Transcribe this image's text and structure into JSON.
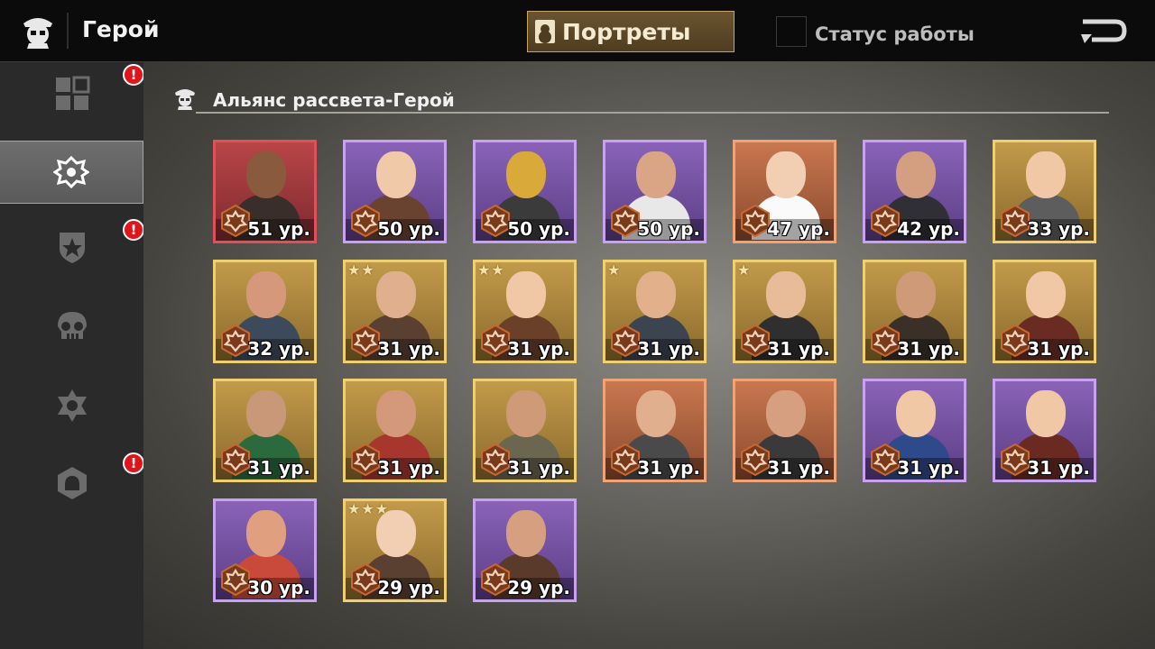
{
  "header": {
    "title": "Герой",
    "portraits_label": "Портреты",
    "status_label": "Статус работы",
    "status_checked": false
  },
  "sidebar": {
    "items": [
      {
        "name": "grid-icon",
        "badge": "!",
        "active": false
      },
      {
        "name": "alliance-emblem-icon",
        "badge": "",
        "active": true
      },
      {
        "name": "star-shield-icon",
        "badge": "!",
        "active": false
      },
      {
        "name": "skull-icon",
        "badge": "",
        "active": false
      },
      {
        "name": "hexagram-icon",
        "badge": "",
        "active": false
      },
      {
        "name": "helmet-hex-icon",
        "badge": "!",
        "active": false
      }
    ]
  },
  "section": {
    "title": "Альянс рассвета-Герой"
  },
  "heroes": [
    {
      "level": "51 ур.",
      "rarity": "red",
      "stars": "",
      "skin": "#8a5a3e",
      "outfit": "#3a2e2a"
    },
    {
      "level": "50 ур.",
      "rarity": "purple",
      "stars": "",
      "skin": "#f0c9a8",
      "outfit": "#6a4330"
    },
    {
      "level": "50 ур.",
      "rarity": "purple",
      "stars": "",
      "skin": "#d9a93a",
      "outfit": "#3b3b3b"
    },
    {
      "level": "50 ур.",
      "rarity": "purple",
      "stars": "",
      "skin": "#d9a585",
      "outfit": "#e8e8e8"
    },
    {
      "level": "47 ур.",
      "rarity": "orange",
      "stars": "",
      "skin": "#f2cfb2",
      "outfit": "#fafafa"
    },
    {
      "level": "42 ур.",
      "rarity": "purple",
      "stars": "",
      "skin": "#d49f80",
      "outfit": "#2f2f35"
    },
    {
      "level": "33 ур.",
      "rarity": "gold",
      "stars": "",
      "skin": "#f0c8a5",
      "outfit": "#5d5d5d"
    },
    {
      "level": "32 ур.",
      "rarity": "gold",
      "stars": "",
      "skin": "#d6987a",
      "outfit": "#3c4a5c"
    },
    {
      "level": "31 ур.",
      "rarity": "gold",
      "stars": "★★",
      "skin": "#e0b08e",
      "outfit": "#5a4030"
    },
    {
      "level": "31 ур.",
      "rarity": "gold",
      "stars": "★★",
      "skin": "#f0c8a5",
      "outfit": "#6a4028"
    },
    {
      "level": "31 ур.",
      "rarity": "gold",
      "stars": "★",
      "skin": "#e2b08a",
      "outfit": "#3c4450"
    },
    {
      "level": "31 ур.",
      "rarity": "gold",
      "stars": "★",
      "skin": "#e8bc98",
      "outfit": "#2f2f2f"
    },
    {
      "level": "31 ур.",
      "rarity": "gold",
      "stars": "",
      "skin": "#cf9a78",
      "outfit": "#3a3028"
    },
    {
      "level": "31 ур.",
      "rarity": "gold",
      "stars": "",
      "skin": "#f0c8a5",
      "outfit": "#6a2c22"
    },
    {
      "level": "31 ур.",
      "rarity": "gold",
      "stars": "",
      "skin": "#c89878",
      "outfit": "#2a6a3c"
    },
    {
      "level": "31 ур.",
      "rarity": "gold",
      "stars": "",
      "skin": "#d4987a",
      "outfit": "#a6362e"
    },
    {
      "level": "31 ур.",
      "rarity": "gold",
      "stars": "",
      "skin": "#cf9a78",
      "outfit": "#6a6650"
    },
    {
      "level": "31 ур.",
      "rarity": "orange",
      "stars": "",
      "skin": "#e0b08e",
      "outfit": "#4a4a4a"
    },
    {
      "level": "31 ур.",
      "rarity": "orange",
      "stars": "",
      "skin": "#d6a080",
      "outfit": "#3a3a3a"
    },
    {
      "level": "31 ур.",
      "rarity": "purple",
      "stars": "",
      "skin": "#f0c8a5",
      "outfit": "#2e4a8a"
    },
    {
      "level": "31 ур.",
      "rarity": "purple",
      "stars": "",
      "skin": "#f0c8a5",
      "outfit": "#6a2a22"
    },
    {
      "level": "30 ур.",
      "rarity": "purple",
      "stars": "",
      "skin": "#e0a080",
      "outfit": "#c94a3a"
    },
    {
      "level": "29 ур.",
      "rarity": "gold",
      "stars": "★★★",
      "skin": "#f2cfb2",
      "outfit": "#5a4030"
    },
    {
      "level": "29 ур.",
      "rarity": "purple",
      "stars": "",
      "skin": "#d6a080",
      "outfit": "#5a3a2a"
    }
  ]
}
